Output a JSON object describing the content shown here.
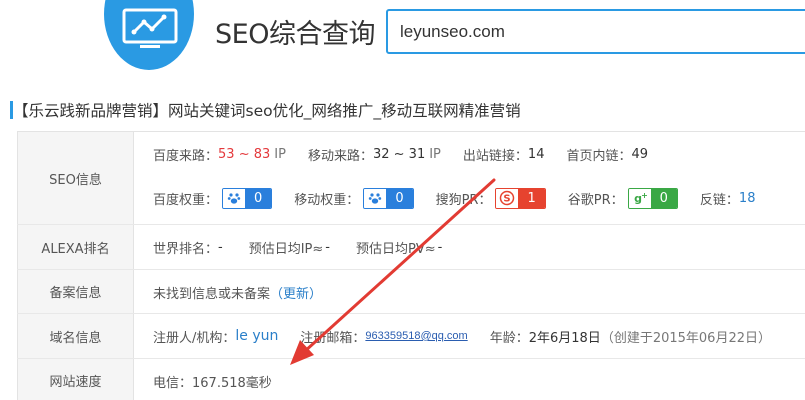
{
  "header": {
    "app_title": "SEO综合查询",
    "domain_value": "leyunseo.com"
  },
  "site_title": {
    "bracket_text": "【乐云践新品牌营销】",
    "rest_text": "网站关键词seo优化_网络推广_移动互联网精准营销"
  },
  "rows": {
    "seo": {
      "label": "SEO信息",
      "baidu_traffic_label": "百度来路：",
      "baidu_traffic_value": "53 ~ 83",
      "baidu_traffic_unit": "IP",
      "mobile_traffic_label": "移动来路：",
      "mobile_traffic_value": "32 ~ 31",
      "mobile_traffic_unit": "IP",
      "outbound_label": "出站链接：",
      "outbound_value": "14",
      "inbound_label": "首页内链：",
      "inbound_value": "49",
      "baidu_weight_label": "百度权重：",
      "baidu_weight_value": "0",
      "mobile_weight_label": "移动权重：",
      "mobile_weight_value": "0",
      "sogou_pr_label": "搜狗PR：",
      "sogou_pr_value": "1",
      "google_pr_label": "谷歌PR：",
      "google_pr_value": "0",
      "backlinks_label": "反链：",
      "backlinks_value": "18"
    },
    "alexa": {
      "label": "ALEXA排名",
      "world_rank_label": "世界排名：",
      "world_rank_value": "-",
      "daily_ip_label": "预估日均IP≈",
      "daily_ip_value": "-",
      "daily_pv_label": "预估日均PV≈",
      "daily_pv_value": "-"
    },
    "icp": {
      "label": "备案信息",
      "text": "未找到信息或未备案",
      "update_link": "（更新）"
    },
    "domain": {
      "label": "域名信息",
      "registrant_label": "注册人/机构：",
      "registrant_value": "le yun",
      "email_label": "注册邮箱：",
      "email_value": "963359518@qq.com",
      "age_label": "年龄：",
      "age_value": "2年6月18日",
      "created_text": "（创建于2015年06月22日）"
    },
    "speed": {
      "label": "网站速度",
      "value": "电信：167.518毫秒"
    }
  },
  "colors": {
    "accent": "#2a9ae3",
    "red_value": "#e4393c",
    "arrow": "#e23b33",
    "baidu_badge": "#2a7fdc",
    "sogou_badge": "#e6432f",
    "google_badge": "#3aa845"
  },
  "icons": [
    "monitor-chart-icon",
    "baidu-paw-icon",
    "sogou-s-icon",
    "google-plus-icon",
    "red-arrow-annotation"
  ]
}
